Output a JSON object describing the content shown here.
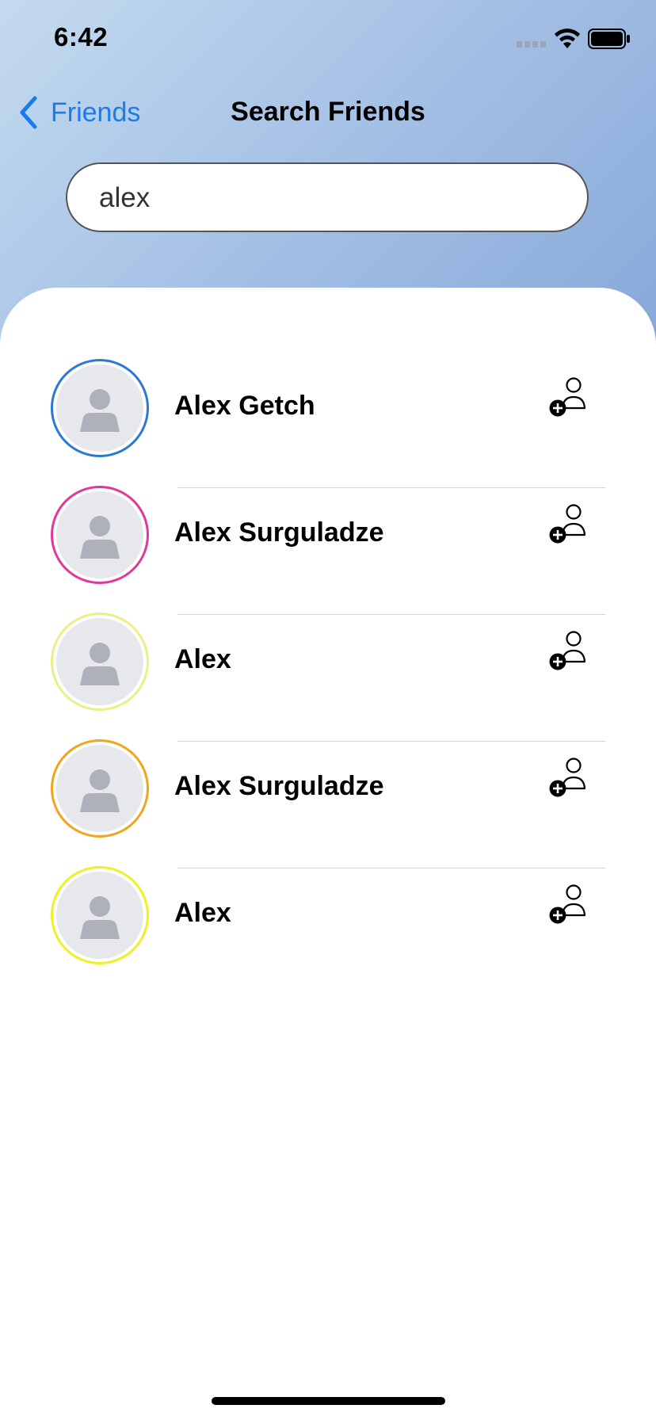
{
  "status_bar": {
    "time": "6:42",
    "icons": [
      "cellular-signal-icon",
      "wifi-icon",
      "battery-icon"
    ]
  },
  "nav": {
    "back_label": "Friends",
    "title": "Search Friends"
  },
  "search": {
    "value": "alex"
  },
  "results": [
    {
      "name": "Alex Getch",
      "ring_color": "#2b78d6"
    },
    {
      "name": "Alex Surguladze",
      "ring_color": "#e0399a"
    },
    {
      "name": "Alex",
      "ring_color": "#ecef86"
    },
    {
      "name": "Alex Surguladze",
      "ring_color": "#f2a51c"
    },
    {
      "name": "Alex",
      "ring_color": "#eef028"
    }
  ],
  "colors": {
    "accent": "#1a7bea",
    "gradient_start": "#c4daee",
    "gradient_end": "#86a7d9"
  }
}
